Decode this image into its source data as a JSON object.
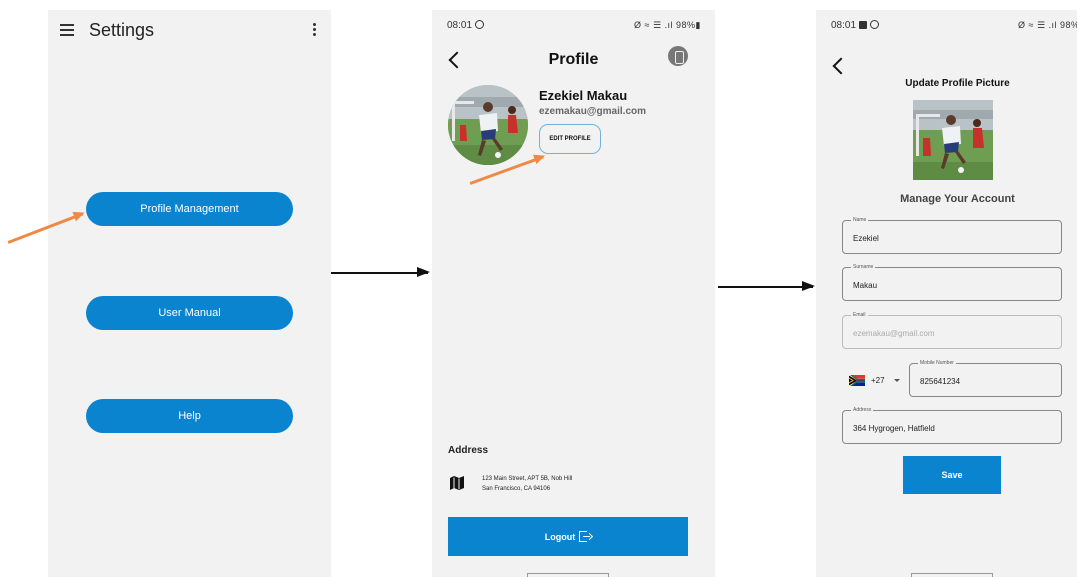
{
  "screen_settings": {
    "title": "Settings",
    "buttons": [
      "Profile Management",
      "User Manual",
      "Help"
    ]
  },
  "screen_profile": {
    "status_time": "08:01",
    "status_icons": "Ø ≈ ☰ .ıl 98%▮",
    "title": "Profile",
    "name": "Ezekiel Makau",
    "email": "ezemakau@gmail.com",
    "edit_label": "EDIT PROFILE",
    "address_heading": "Address",
    "address_line1": "123 Main Street, APT 5B, Nob Hill",
    "address_line2": "San Francisco, CA 94106",
    "logout_label": "Logout"
  },
  "screen_update": {
    "status_time": "08:01",
    "status_icons": "Ø ≈ ☰ .ıl 98%▮",
    "heading": "Update Profile Picture",
    "subheading": "Manage Your Account",
    "fields": [
      {
        "label": "Name",
        "value": "Ezekiel"
      },
      {
        "label": "Surname",
        "value": "Makau"
      },
      {
        "label": "Email",
        "value": "ezemakau@gmail.com"
      },
      {
        "label": "Mobile Number",
        "value": "825641234"
      },
      {
        "label": "Address",
        "value": "364 Hygrogen, Hatfield"
      }
    ],
    "dial_code": "+27",
    "save_label": "Save"
  },
  "colors": {
    "primary": "#0b84d0",
    "annotation": "#ee8a45",
    "background": "#f2f2f2"
  }
}
